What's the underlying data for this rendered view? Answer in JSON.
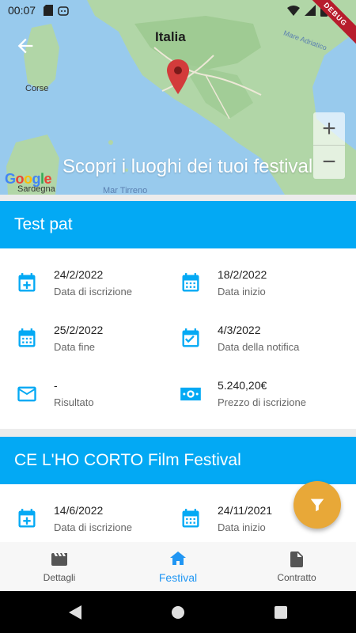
{
  "status_bar": {
    "time": "00:07",
    "debug_banner": "DEBUG"
  },
  "map": {
    "title": "Scopri i luoghi dei tuoi festival",
    "labels": {
      "italia": "Italia",
      "adriatico": "Mare Adriatico",
      "corse": "Corse",
      "sardegna": "Sardegna",
      "tirreno": "Mar Tirreno"
    },
    "attribution": "Google",
    "zoom_in": "+",
    "zoom_out": "−"
  },
  "cards": [
    {
      "title": "Test pat",
      "fields": [
        {
          "icon": "calendar-plus-icon",
          "value": "24/2/2022",
          "label": "Data di iscrizione"
        },
        {
          "icon": "calendar-grid-icon",
          "value": "18/2/2022",
          "label": "Data inizio"
        },
        {
          "icon": "calendar-grid-icon",
          "value": "25/2/2022",
          "label": "Data fine"
        },
        {
          "icon": "calendar-check-icon",
          "value": "4/3/2022",
          "label": "Data della notifica"
        },
        {
          "icon": "mail-icon",
          "value": "-",
          "label": "Risultato"
        },
        {
          "icon": "money-icon",
          "value": "5.240,20€",
          "label": "Prezzo di iscrizione"
        }
      ]
    },
    {
      "title": "CE L'HO CORTO Film Festival",
      "fields": [
        {
          "icon": "calendar-plus-icon",
          "value": "14/6/2022",
          "label": "Data di iscrizione"
        },
        {
          "icon": "calendar-grid-icon",
          "value": "24/11/2021",
          "label": "Data inizio"
        }
      ]
    }
  ],
  "bottom_nav": {
    "items": [
      {
        "label": "Dettagli",
        "icon": "clapperboard-icon",
        "active": false
      },
      {
        "label": "Festival",
        "icon": "home-icon",
        "active": true
      },
      {
        "label": "Contratto",
        "icon": "document-icon",
        "active": false
      }
    ]
  },
  "colors": {
    "primary": "#03a9f4",
    "accent": "#e8a838",
    "nav_active": "#2196f3"
  }
}
